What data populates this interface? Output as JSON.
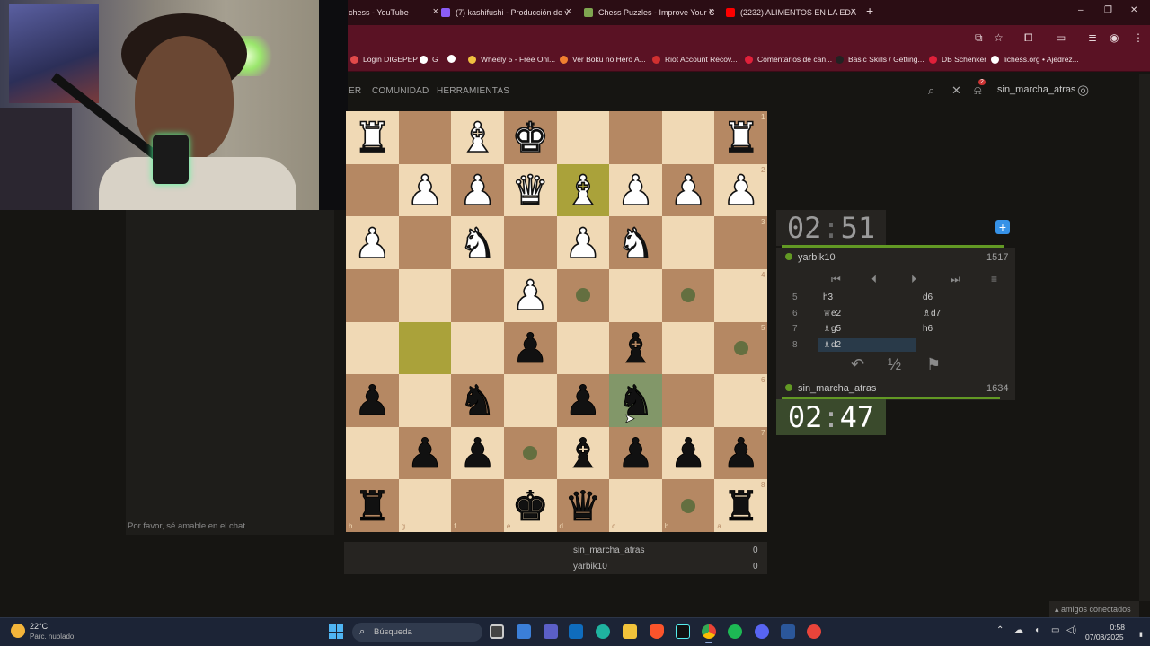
{
  "browser": {
    "tabs": [
      {
        "label": "chess - YouTube",
        "color": "#ff0000"
      },
      {
        "label": "(7) kashifushi - Producción de v",
        "color": "#8b5cf6"
      },
      {
        "label": "Chess Puzzles - Improve Your C",
        "color": "#7fa650"
      },
      {
        "label": "(2232) ALIMENTOS EN LA EDAD",
        "color": "#ff0000"
      }
    ],
    "new_tab": "+",
    "close": "×",
    "window": {
      "minimize": "–",
      "restore": "❐",
      "close": "✕"
    }
  },
  "bookmarks": [
    {
      "label": "Login DIGEPEP",
      "color": "#e24a4a"
    },
    {
      "label": "G",
      "color": "#ffffff"
    },
    {
      "label": "",
      "color": "#ffffff"
    },
    {
      "label": "Wheely 5 - Free Onl...",
      "color": "#f0c040"
    },
    {
      "label": "Ver Boku no Hero A...",
      "color": "#f08030"
    },
    {
      "label": "Riot Account Recov...",
      "color": "#d03030"
    },
    {
      "label": "Comentarios de can...",
      "color": "#e0203a"
    },
    {
      "label": "Basic Skills / Getting...",
      "color": "#222222"
    },
    {
      "label": "DB Schenker",
      "color": "#e0203a"
    },
    {
      "label": "lichess.org • Ajedrez...",
      "color": "#ffffff"
    }
  ],
  "site": {
    "nav": [
      "ER",
      "COMUNIDAD",
      "HERRAMIENTAS"
    ],
    "notifications": "2",
    "username": "sin_marcha_atras"
  },
  "chat": {
    "placeholder": "Por favor, sé amable en el chat"
  },
  "board": {
    "ranks": [
      "1",
      "2",
      "3",
      "4",
      "5",
      "6",
      "7",
      "8"
    ],
    "files": [
      "h",
      "g",
      "f",
      "e",
      "d",
      "c",
      "b",
      "a"
    ],
    "pieces": [
      [
        "wR",
        "",
        "wB",
        "wK",
        "",
        "",
        "",
        "wR"
      ],
      [
        "",
        "wP",
        "wP",
        "wQ",
        "wB",
        "wP",
        "wP",
        "wP"
      ],
      [
        "wP",
        "",
        "wN",
        "",
        "wP",
        "wN",
        "",
        ""
      ],
      [
        "",
        "",
        "",
        "wP",
        "",
        "",
        "",
        ""
      ],
      [
        "",
        "",
        "",
        "bP",
        "",
        "bB",
        "",
        ""
      ],
      [
        "bP",
        "",
        "bN",
        "",
        "bP",
        "bN",
        "",
        ""
      ],
      [
        "",
        "bP",
        "bP",
        "",
        "bB",
        "bP",
        "bP",
        "bP"
      ],
      [
        "bR",
        "",
        "",
        "bK",
        "bQ",
        "",
        "",
        "bR"
      ]
    ],
    "highlights": [
      [
        1,
        4
      ],
      [
        4,
        1
      ]
    ],
    "lastmove": [
      [
        5,
        5
      ]
    ],
    "dots": [
      [
        3,
        4
      ],
      [
        3,
        6
      ],
      [
        4,
        7
      ],
      [
        6,
        3
      ],
      [
        7,
        6
      ]
    ]
  },
  "game": {
    "top_player": {
      "name": "yarbik10",
      "rating": "1517",
      "clock_min": "02",
      "clock_sec": "51"
    },
    "bottom_player": {
      "name": "sin_marcha_atras",
      "rating": "1634",
      "clock_min": "02",
      "clock_sec": "47"
    },
    "moves": [
      {
        "num": "5",
        "white": "h3",
        "black": "d6"
      },
      {
        "num": "6",
        "white": "♕e2",
        "black": "♗d7"
      },
      {
        "num": "7",
        "white": "♗g5",
        "black": "h6"
      },
      {
        "num": "8",
        "white": "♗d2",
        "black": ""
      }
    ],
    "draw": "½",
    "plus": "+",
    "controls": [
      "⏮",
      "⏴",
      "⏵",
      "⏭",
      "≡"
    ]
  },
  "underboard": [
    {
      "name": "sin_marcha_atras",
      "score": "0"
    },
    {
      "name": "yarbik10",
      "score": "0"
    }
  ],
  "friends": "amigos conectados",
  "taskbar": {
    "weather_temp": "22°C",
    "weather_status": "Parc. nublado",
    "search_placeholder": "Búsqueda",
    "time": "0:58",
    "date": "07/08/2025"
  }
}
